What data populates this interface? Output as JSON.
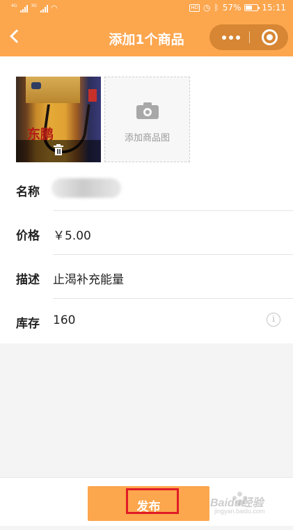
{
  "status_bar": {
    "signal1_tag": "4G",
    "signal2_tag": "3G",
    "network_icon": "wifi-icon",
    "hd_badge": "HD",
    "battery_text": "57%",
    "battery_level": 0.57,
    "time": "15:11"
  },
  "nav": {
    "title": "添加1个商品",
    "back_icon": "chevron-left-icon",
    "more_icon": "more-dots-icon",
    "close_icon": "target-circle-icon"
  },
  "photos": {
    "product_brand_text": "东鹏",
    "delete_icon": "trash-icon",
    "add_label": "添加商品图",
    "add_icon": "camera-icon"
  },
  "form": {
    "name_label": "名称",
    "name_value": "",
    "price_label": "价格",
    "price_value": "￥5.00",
    "desc_label": "描述",
    "desc_value": "止渴补充能量",
    "stock_label": "库存",
    "stock_value": "160",
    "info_icon": "info-icon",
    "info_glyph": "i"
  },
  "actions": {
    "publish_label": "发布"
  },
  "watermark": {
    "text": "Baidu经验",
    "sub": "jingyan.baidu.com"
  },
  "colors": {
    "accent": "#fca64e",
    "highlight_box": "#e01b25"
  }
}
